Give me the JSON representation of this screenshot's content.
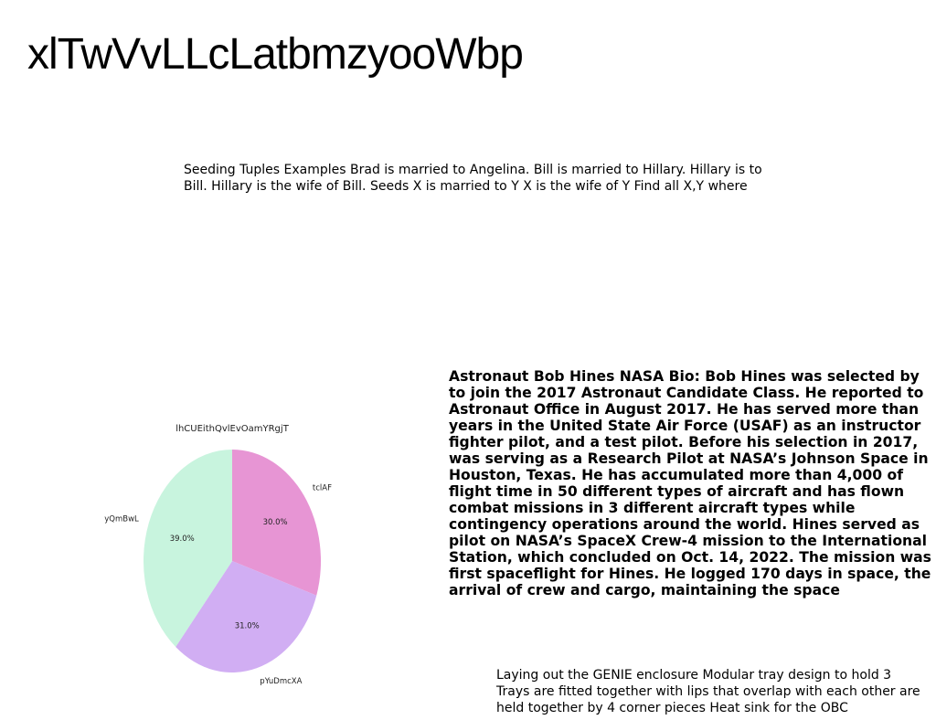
{
  "title": "xlTwVvLLcLatbmzyooWbp",
  "paragraph_top": "Seeding Tuples Examples Brad is married to Angelina. Bill is married to Hillary. Hillary is to Bill. Hillary is the wife of Bill. Seeds X is married to Y X is the wife of Y Find all X,Y where",
  "paragraph_bio": "Astronaut Bob Hines NASA Bio: Bob Hines was selected by to join the 2017 Astronaut Candidate Class. He reported to Astronaut Office in August 2017. He has served more than years in the United State Air Force (USAF) as an instructor fighter pilot, and a test pilot. Before his selection in 2017, was serving as a Research Pilot at NASA’s Johnson Space in Houston, Texas. He has accumulated more than 4,000 of flight time in 50 different types of aircraft and has flown combat missions in 3 different aircraft types while contingency operations around the world. Hines served as pilot on NASA’s SpaceX Crew-4 mission to the International Station, which concluded on Oct. 14, 2022. The mission was first spaceflight for Hines. He logged 170 days in space, the arrival of crew and cargo, maintaining the space",
  "paragraph_bottom": "Laying out the GENIE enclosure  Modular tray design to hold 3  Trays are fitted together with lips that overlap with each other  are held together by 4 corner pieces  Heat sink for the OBC",
  "chart_data": {
    "type": "pie",
    "title": "lhCUEithQvlEvOamYRgjT",
    "slices": [
      {
        "label": "tclAF",
        "value": 30.0,
        "pct_label": "30.0%",
        "color": "#e795d4"
      },
      {
        "label": "pYuDmcXA",
        "value": 31.0,
        "pct_label": "31.0%",
        "color": "#d1aef3"
      },
      {
        "label": "yQmBwL",
        "value": 39.0,
        "pct_label": "39.0%",
        "color": "#c8f4de"
      }
    ]
  }
}
